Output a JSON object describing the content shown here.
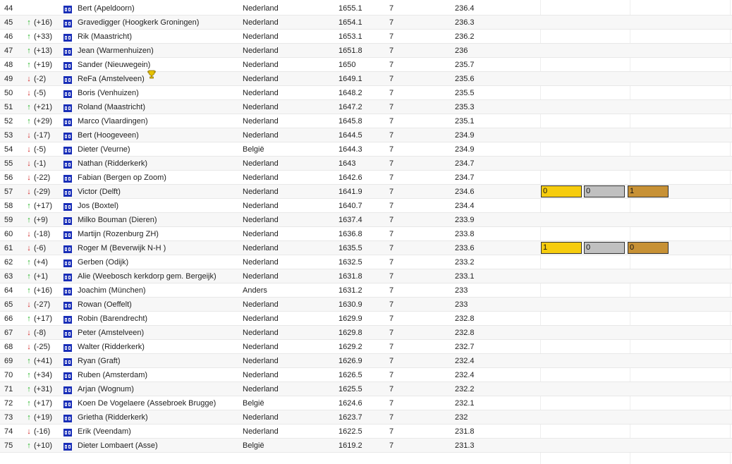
{
  "colors": {
    "up": "#1fb41f",
    "down": "#d02020",
    "gold": "#f6cc0e",
    "silver": "#c0c0c0",
    "bronze": "#c79135"
  },
  "icons": {
    "flag": "dutch-style-flag-icon",
    "trophy": "trophy-icon",
    "up": "up-arrow-icon",
    "down": "down-arrow-icon"
  },
  "rows": [
    {
      "rank": "44",
      "dir": "",
      "change": "",
      "name": "Bert (Apeldoorn)",
      "country": "Nederland",
      "rating": "1655.1",
      "games": "7",
      "score": "236.4"
    },
    {
      "rank": "45",
      "dir": "up",
      "change": "(+16)",
      "name": "Gravedigger (Hoogkerk Groningen)",
      "country": "Nederland",
      "rating": "1654.1",
      "games": "7",
      "score": "236.3"
    },
    {
      "rank": "46",
      "dir": "up",
      "change": "(+33)",
      "name": "Rik (Maastricht)",
      "country": "Nederland",
      "rating": "1653.1",
      "games": "7",
      "score": "236.2"
    },
    {
      "rank": "47",
      "dir": "up",
      "change": "(+13)",
      "name": "Jean (Warmenhuizen)",
      "country": "Nederland",
      "rating": "1651.8",
      "games": "7",
      "score": "236"
    },
    {
      "rank": "48",
      "dir": "up",
      "change": "(+19)",
      "name": "Sander (Nieuwegein)",
      "country": "Nederland",
      "rating": "1650",
      "games": "7",
      "score": "235.7"
    },
    {
      "rank": "49",
      "dir": "down",
      "change": "(-2)",
      "name": "ReFa (Amstelveen)",
      "country": "Nederland",
      "rating": "1649.1",
      "games": "7",
      "score": "235.6",
      "trophy": true
    },
    {
      "rank": "50",
      "dir": "down",
      "change": "(-5)",
      "name": "Boris (Venhuizen)",
      "country": "Nederland",
      "rating": "1648.2",
      "games": "7",
      "score": "235.5"
    },
    {
      "rank": "51",
      "dir": "up",
      "change": "(+21)",
      "name": "Roland (Maastricht)",
      "country": "Nederland",
      "rating": "1647.2",
      "games": "7",
      "score": "235.3"
    },
    {
      "rank": "52",
      "dir": "up",
      "change": "(+29)",
      "name": "Marco (Vlaardingen)",
      "country": "Nederland",
      "rating": "1645.8",
      "games": "7",
      "score": "235.1"
    },
    {
      "rank": "53",
      "dir": "down",
      "change": "(-17)",
      "name": "Bert (Hoogeveen)",
      "country": "Nederland",
      "rating": "1644.5",
      "games": "7",
      "score": "234.9"
    },
    {
      "rank": "54",
      "dir": "down",
      "change": "(-5)",
      "name": "Dieter (Veurne)",
      "country": "België",
      "rating": "1644.3",
      "games": "7",
      "score": "234.9"
    },
    {
      "rank": "55",
      "dir": "down",
      "change": "(-1)",
      "name": "Nathan (Ridderkerk)",
      "country": "Nederland",
      "rating": "1643",
      "games": "7",
      "score": "234.7"
    },
    {
      "rank": "56",
      "dir": "down",
      "change": "(-22)",
      "name": "Fabian (Bergen op Zoom)",
      "country": "Nederland",
      "rating": "1642.6",
      "games": "7",
      "score": "234.7"
    },
    {
      "rank": "57",
      "dir": "down",
      "change": "(-29)",
      "name": "Victor (Delft)",
      "country": "Nederland",
      "rating": "1641.9",
      "games": "7",
      "score": "234.6",
      "medals": {
        "gold": "0",
        "silver": "0",
        "bronze": "1"
      }
    },
    {
      "rank": "58",
      "dir": "up",
      "change": "(+17)",
      "name": "Jos (Boxtel)",
      "country": "Nederland",
      "rating": "1640.7",
      "games": "7",
      "score": "234.4"
    },
    {
      "rank": "59",
      "dir": "up",
      "change": "(+9)",
      "name": "Milko Bouman (Dieren)",
      "country": "Nederland",
      "rating": "1637.4",
      "games": "7",
      "score": "233.9"
    },
    {
      "rank": "60",
      "dir": "down",
      "change": "(-18)",
      "name": "Martijn (Rozenburg ZH)",
      "country": "Nederland",
      "rating": "1636.8",
      "games": "7",
      "score": "233.8"
    },
    {
      "rank": "61",
      "dir": "down",
      "change": "(-6)",
      "name": "Roger M (Beverwijk N-H )",
      "country": "Nederland",
      "rating": "1635.5",
      "games": "7",
      "score": "233.6",
      "medals": {
        "gold": "1",
        "silver": "0",
        "bronze": "0"
      }
    },
    {
      "rank": "62",
      "dir": "up",
      "change": "(+4)",
      "name": "Gerben (Odijk)",
      "country": "Nederland",
      "rating": "1632.5",
      "games": "7",
      "score": "233.2"
    },
    {
      "rank": "63",
      "dir": "up",
      "change": "(+1)",
      "name": "Alie (Weebosch kerkdorp gem. Bergeijk)",
      "country": "Nederland",
      "rating": "1631.8",
      "games": "7",
      "score": "233.1"
    },
    {
      "rank": "64",
      "dir": "up",
      "change": "(+16)",
      "name": "Joachim (München)",
      "country": "Anders",
      "rating": "1631.2",
      "games": "7",
      "score": "233"
    },
    {
      "rank": "65",
      "dir": "down",
      "change": "(-27)",
      "name": "Rowan (Oeffelt)",
      "country": "Nederland",
      "rating": "1630.9",
      "games": "7",
      "score": "233"
    },
    {
      "rank": "66",
      "dir": "up",
      "change": "(+17)",
      "name": "Robin (Barendrecht)",
      "country": "Nederland",
      "rating": "1629.9",
      "games": "7",
      "score": "232.8"
    },
    {
      "rank": "67",
      "dir": "down",
      "change": "(-8)",
      "name": "Peter (Amstelveen)",
      "country": "Nederland",
      "rating": "1629.8",
      "games": "7",
      "score": "232.8"
    },
    {
      "rank": "68",
      "dir": "down",
      "change": "(-25)",
      "name": "Walter (Ridderkerk)",
      "country": "Nederland",
      "rating": "1629.2",
      "games": "7",
      "score": "232.7"
    },
    {
      "rank": "69",
      "dir": "up",
      "change": "(+41)",
      "name": "Ryan (Graft)",
      "country": "Nederland",
      "rating": "1626.9",
      "games": "7",
      "score": "232.4"
    },
    {
      "rank": "70",
      "dir": "up",
      "change": "(+34)",
      "name": "Ruben (Amsterdam)",
      "country": "Nederland",
      "rating": "1626.5",
      "games": "7",
      "score": "232.4"
    },
    {
      "rank": "71",
      "dir": "up",
      "change": "(+31)",
      "name": "Arjan (Wognum)",
      "country": "Nederland",
      "rating": "1625.5",
      "games": "7",
      "score": "232.2"
    },
    {
      "rank": "72",
      "dir": "up",
      "change": "(+17)",
      "name": "Koen De Vogelaere (Assebroek Brugge)",
      "country": "België",
      "rating": "1624.6",
      "games": "7",
      "score": "232.1"
    },
    {
      "rank": "73",
      "dir": "up",
      "change": "(+19)",
      "name": "Grietha (Ridderkerk)",
      "country": "Nederland",
      "rating": "1623.7",
      "games": "7",
      "score": "232"
    },
    {
      "rank": "74",
      "dir": "down",
      "change": "(-16)",
      "name": "Erik (Veendam)",
      "country": "Nederland",
      "rating": "1622.5",
      "games": "7",
      "score": "231.8"
    },
    {
      "rank": "75",
      "dir": "up",
      "change": "(+10)",
      "name": "Dieter Lombaert (Asse)",
      "country": "België",
      "rating": "1619.2",
      "games": "7",
      "score": "231.3"
    }
  ]
}
